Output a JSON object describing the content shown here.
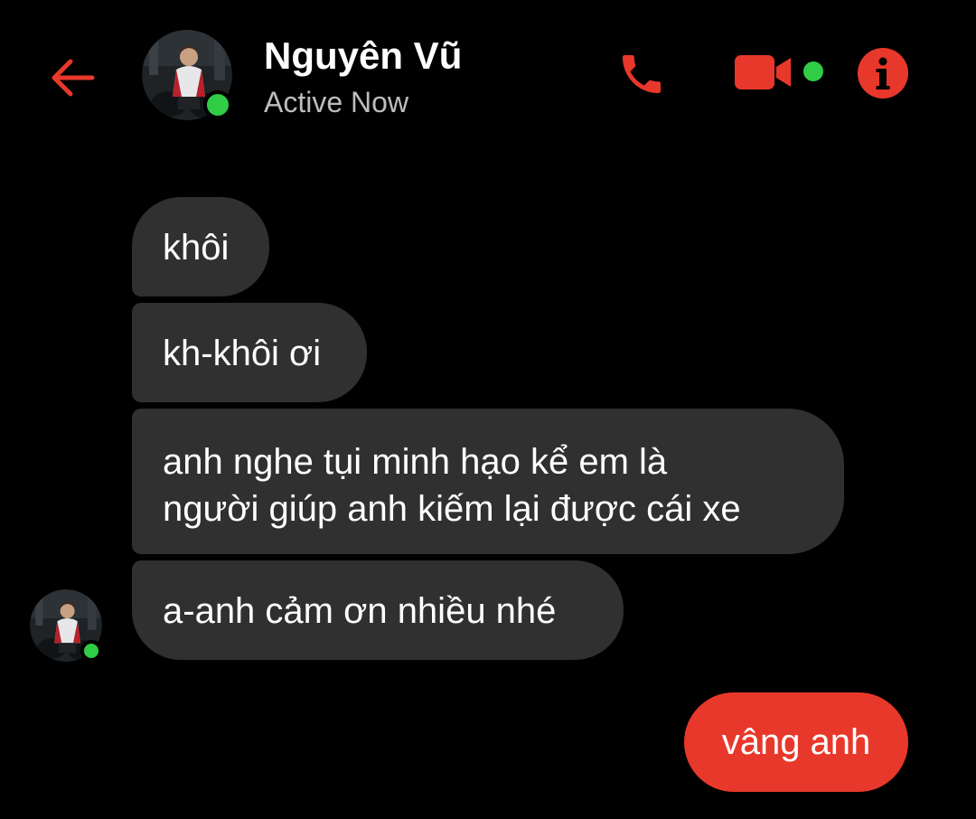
{
  "header": {
    "contact_name": "Nguyên Vũ",
    "status": "Active Now",
    "icons": {
      "back": "back-arrow-icon",
      "phone": "phone-icon",
      "video": "video-camera-icon",
      "info": "info-icon"
    }
  },
  "messages": [
    {
      "direction": "incoming",
      "text": "khôi"
    },
    {
      "direction": "incoming",
      "text": "kh-khôi ơi"
    },
    {
      "direction": "incoming",
      "lines": [
        "anh nghe tụi minh hạo kể em là",
        "người giúp anh kiếm lại được cái xe"
      ]
    },
    {
      "direction": "incoming",
      "text": "a-anh cảm ơn nhiều nhé"
    },
    {
      "direction": "outgoing",
      "text": "vâng anh"
    }
  ],
  "colors": {
    "background": "#000000",
    "accent": "#e8382b",
    "incoming_bubble": "#303030",
    "online": "#31cc46",
    "status_text": "#bdbdbd"
  }
}
